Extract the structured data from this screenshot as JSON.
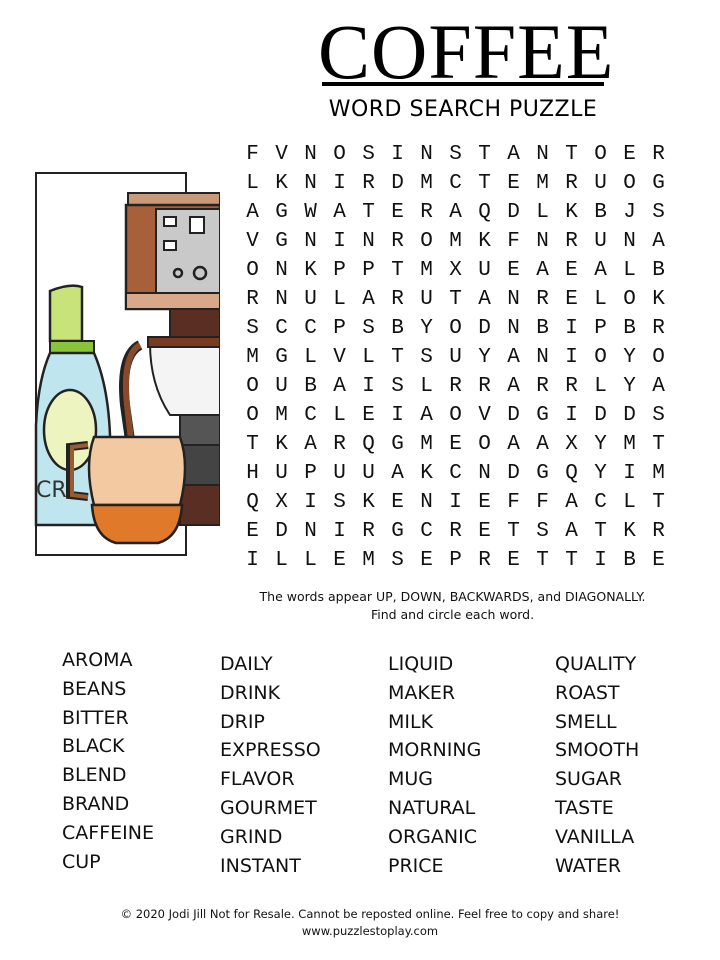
{
  "header": {
    "title": "COFFEE",
    "subtitle": "WORD SEARCH PUZZLE"
  },
  "illustration": {
    "icon": "coffee-maker-illustration",
    "label_fragment": "CRI"
  },
  "grid": {
    "rows": [
      [
        "F",
        "V",
        "N",
        "O",
        "S",
        "I",
        "N",
        "S",
        "T",
        "A",
        "N",
        "T",
        "O",
        "E",
        "R"
      ],
      [
        "L",
        "K",
        "N",
        "I",
        "R",
        "D",
        "M",
        "C",
        "T",
        "E",
        "M",
        "R",
        "U",
        "O",
        "G"
      ],
      [
        "A",
        "G",
        "W",
        "A",
        "T",
        "E",
        "R",
        "A",
        "Q",
        "D",
        "L",
        "K",
        "B",
        "J",
        "S"
      ],
      [
        "V",
        "G",
        "N",
        "I",
        "N",
        "R",
        "O",
        "M",
        "K",
        "F",
        "N",
        "R",
        "U",
        "N",
        "A"
      ],
      [
        "O",
        "N",
        "K",
        "P",
        "P",
        "T",
        "M",
        "X",
        "U",
        "E",
        "A",
        "E",
        "A",
        "L",
        "B"
      ],
      [
        "R",
        "N",
        "U",
        "L",
        "A",
        "R",
        "U",
        "T",
        "A",
        "N",
        "R",
        "E",
        "L",
        "O",
        "K"
      ],
      [
        "S",
        "C",
        "C",
        "P",
        "S",
        "B",
        "Y",
        "O",
        "D",
        "N",
        "B",
        "I",
        "P",
        "B",
        "R"
      ],
      [
        "M",
        "G",
        "L",
        "V",
        "L",
        "T",
        "S",
        "U",
        "Y",
        "A",
        "N",
        "I",
        "O",
        "Y",
        "O"
      ],
      [
        "O",
        "U",
        "B",
        "A",
        "I",
        "S",
        "L",
        "R",
        "R",
        "A",
        "R",
        "R",
        "L",
        "Y",
        "A"
      ],
      [
        "O",
        "M",
        "C",
        "L",
        "E",
        "I",
        "A",
        "O",
        "V",
        "D",
        "G",
        "I",
        "D",
        "D",
        "S"
      ],
      [
        "T",
        "K",
        "A",
        "R",
        "Q",
        "G",
        "M",
        "E",
        "O",
        "A",
        "A",
        "X",
        "Y",
        "M",
        "T"
      ],
      [
        "H",
        "U",
        "P",
        "U",
        "U",
        "A",
        "K",
        "C",
        "N",
        "D",
        "G",
        "Q",
        "Y",
        "I",
        "M"
      ],
      [
        "Q",
        "X",
        "I",
        "S",
        "K",
        "E",
        "N",
        "I",
        "E",
        "F",
        "F",
        "A",
        "C",
        "L",
        "T"
      ],
      [
        "E",
        "D",
        "N",
        "I",
        "R",
        "G",
        "C",
        "R",
        "E",
        "T",
        "S",
        "A",
        "T",
        "K",
        "R"
      ],
      [
        "I",
        "L",
        "L",
        "E",
        "M",
        "S",
        "E",
        "P",
        "R",
        "E",
        "T",
        "T",
        "I",
        "B",
        "E"
      ]
    ]
  },
  "instructions": {
    "line1": "The words appear UP, DOWN,  BACKWARDS, and DIAGONALLY.",
    "line2": "Find and circle each word."
  },
  "word_list": {
    "columns": [
      [
        "AROMA",
        "BEANS",
        "BITTER",
        "BLACK",
        "BLEND",
        "BRAND",
        "CAFFEINE",
        "CUP"
      ],
      [
        "DAILY",
        "DRINK",
        "DRIP",
        "EXPRESSO",
        "FLAVOR",
        "GOURMET",
        "GRIND",
        "INSTANT"
      ],
      [
        "LIQUID",
        "MAKER",
        "MILK",
        "MORNING",
        "MUG",
        "NATURAL",
        "ORGANIC",
        "PRICE"
      ],
      [
        "QUALITY",
        "ROAST",
        "SMELL",
        "SMOOTH",
        "SUGAR",
        "TASTE",
        "VANILLA",
        "WATER"
      ]
    ]
  },
  "footer": {
    "copyright": "© 2020 Jodi Jill Not for Resale. Cannot be reposted online. Feel free to copy and share!",
    "website": "www.puzzlestoplay.com"
  }
}
